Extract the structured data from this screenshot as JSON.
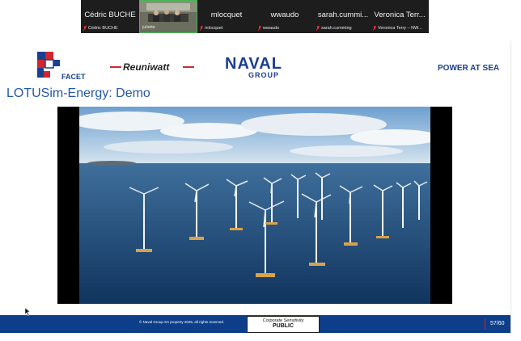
{
  "participants": [
    {
      "big": "Cédric BUCHE",
      "small": "Cédric BUCHE"
    },
    {
      "big": "",
      "small": "juliette"
    },
    {
      "big": "mlocquet",
      "small": "mlocquet"
    },
    {
      "big": "wwaudo",
      "small": "wwaudo"
    },
    {
      "big": "sarah.cummi...",
      "small": "sarah.cumming"
    },
    {
      "big": "Veronica Terr...",
      "small": "Veronica Terry – NW..."
    }
  ],
  "logos": {
    "facet": "FACET",
    "reuniwatt": "Reuniwatt",
    "naval_top": "NAVAL",
    "naval_bottom": "GROUP",
    "tagline": "POWER AT SEA"
  },
  "slide": {
    "title": "LOTUSim-Energy:  Demo",
    "copyright": "© Naval Group SA property 2025, all rights reserved.",
    "sensitivity_label": "Corporate Sensitivity",
    "sensitivity_value": "PUBLIC",
    "page": "57/60"
  },
  "colors": {
    "accent": "#2458a6",
    "footer": "#0d3e8a",
    "naval": "#1b3f8f",
    "reuniwatt_red": "#d0262f"
  }
}
